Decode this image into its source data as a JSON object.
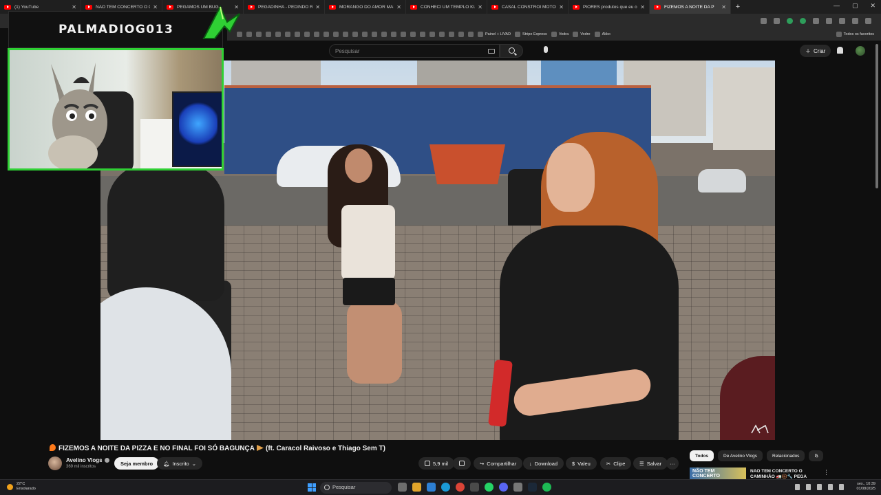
{
  "browser": {
    "tabs": [
      {
        "label": "(1) YouTube",
        "active": false
      },
      {
        "label": "NÃO TEM CONCERTO O CAMI",
        "active": false
      },
      {
        "label": "PEGAMOS UM BUG...",
        "active": false
      },
      {
        "label": "PEGADINHA - PEDINDO REMI",
        "active": false
      },
      {
        "label": "MORANGO DO AMOR MAIS B",
        "active": false
      },
      {
        "label": "CONHECI UM TEMPLO KUNG",
        "active": false
      },
      {
        "label": "CASAL CONSTRÓI MOTORHO",
        "active": false
      },
      {
        "label": "PIORES produtos que eu comp",
        "active": false
      },
      {
        "label": "FIZEMOS A NOITE DA P",
        "active": true
      }
    ],
    "bookmarks": [
      "Painel + LIVAD",
      "Stripe Express",
      "Vodra",
      "Vodre",
      "Akko"
    ],
    "bookmarks_all_label": "Todos os favoritos"
  },
  "youtube": {
    "search_placeholder": "Pesquisar",
    "create_label": "Criar",
    "video": {
      "title": "FIZEMOS A NOITE DA PIZZA E NO FINAL FOI SÓ BAGUNÇA",
      "title_suffix": "(ft. Caracol Raivoso e Thiago Sem T)",
      "channel": "Avelino Vlogs",
      "subscribers": "369 mil inscritos",
      "join_label": "Seja membro",
      "subscribed_label": "Inscrito",
      "likes": "5,9 mil",
      "share_label": "Compartilhar",
      "download_label": "Download",
      "thanks_label": "Valeu",
      "clip_label": "Clipe",
      "save_label": "Salvar",
      "more_label": "···"
    },
    "chips": [
      "Todos",
      "De Avelino Vlogs",
      "Relacionados",
      "P"
    ],
    "recommendation": {
      "thumb_text": "NÃO TEM CONCERTO",
      "title": "NÃO TEM CONCERTO O CAMINHÃO 🚛🛞🔧 PEGA"
    }
  },
  "stream_overlay": {
    "streamer_name": "PALMADIOG013"
  },
  "taskbar": {
    "weather_temp": "22°C",
    "weather_desc": "Ensolarado",
    "search_label": "Pesquisar",
    "time": "sex., 10:39",
    "date": "01/08/2025"
  },
  "colors": {
    "overlay_green": "#2fd034",
    "youtube_red": "#ff0000",
    "page_bg": "#0f0f0f"
  },
  "icons": {
    "search": "search-icon",
    "mic": "mic-icon",
    "bell": "bell-icon",
    "like": "thumbs-up-icon",
    "dislike": "thumbs-down-icon"
  }
}
